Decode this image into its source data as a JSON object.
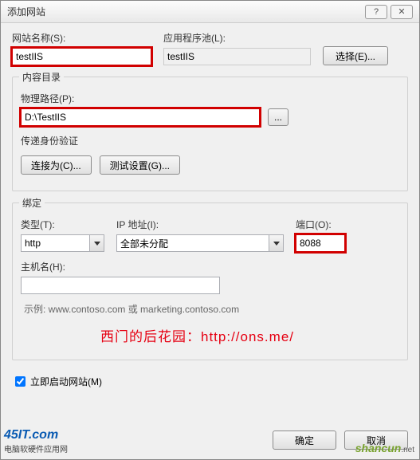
{
  "dialog": {
    "title": "添加网站"
  },
  "site": {
    "name_label": "网站名称(S):",
    "name_value": "testIIS",
    "apppool_label": "应用程序池(L):",
    "apppool_value": "testIIS",
    "select_btn": "选择(E)..."
  },
  "content_dir": {
    "group_title": "内容目录",
    "path_label": "物理路径(P):",
    "path_value": "D:\\TestIIS",
    "browse_dots": "...",
    "passthrough_label": "传递身份验证",
    "connect_as_btn": "连接为(C)...",
    "test_settings_btn": "测试设置(G)..."
  },
  "binding": {
    "group_title": "绑定",
    "type_label": "类型(T):",
    "type_value": "http",
    "ip_label": "IP 地址(I):",
    "ip_value": "全部未分配",
    "port_label": "端口(O):",
    "port_value": "8088",
    "host_label": "主机名(H):",
    "host_value": "",
    "example": "示例: www.contoso.com 或 marketing.contoso.com"
  },
  "watermark": "西门的后花园：http://ons.me/",
  "start_now": {
    "label": "立即启动网站(M)",
    "checked": true
  },
  "footer": {
    "ok": "确定",
    "cancel": "取消"
  },
  "logos": {
    "left_brand": "45IT.com",
    "left_sub": "电脑软硬件应用网",
    "right_brand": "shancun",
    "right_suffix": ".net"
  }
}
